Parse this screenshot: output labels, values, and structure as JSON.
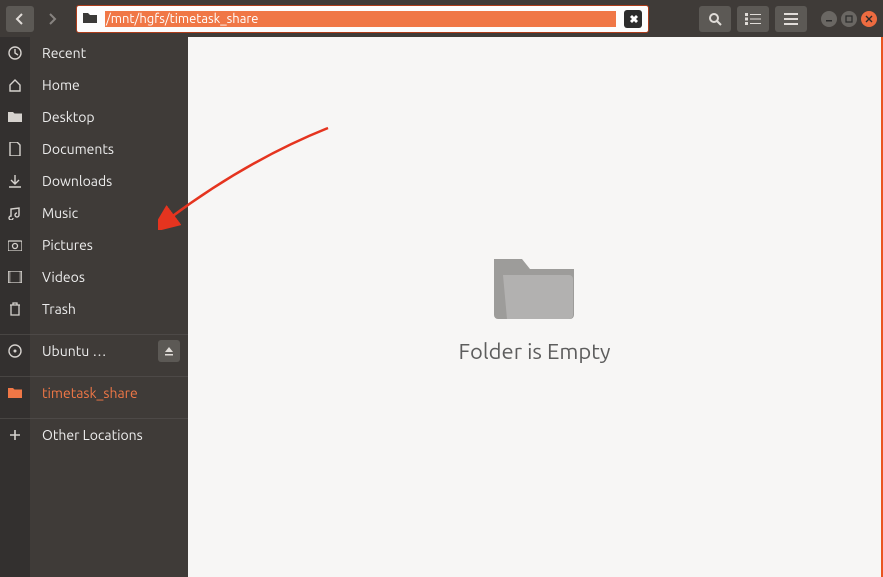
{
  "path": "/mnt/hgfs/timetask_share",
  "sidebar": {
    "items": [
      {
        "label": "Recent"
      },
      {
        "label": "Home"
      },
      {
        "label": "Desktop"
      },
      {
        "label": "Documents"
      },
      {
        "label": "Downloads"
      },
      {
        "label": "Music"
      },
      {
        "label": "Pictures"
      },
      {
        "label": "Videos"
      },
      {
        "label": "Trash"
      },
      {
        "label": "Ubuntu …"
      },
      {
        "label": "timetask_share"
      },
      {
        "label": "Other Locations"
      }
    ]
  },
  "content": {
    "empty_message": "Folder is Empty"
  }
}
